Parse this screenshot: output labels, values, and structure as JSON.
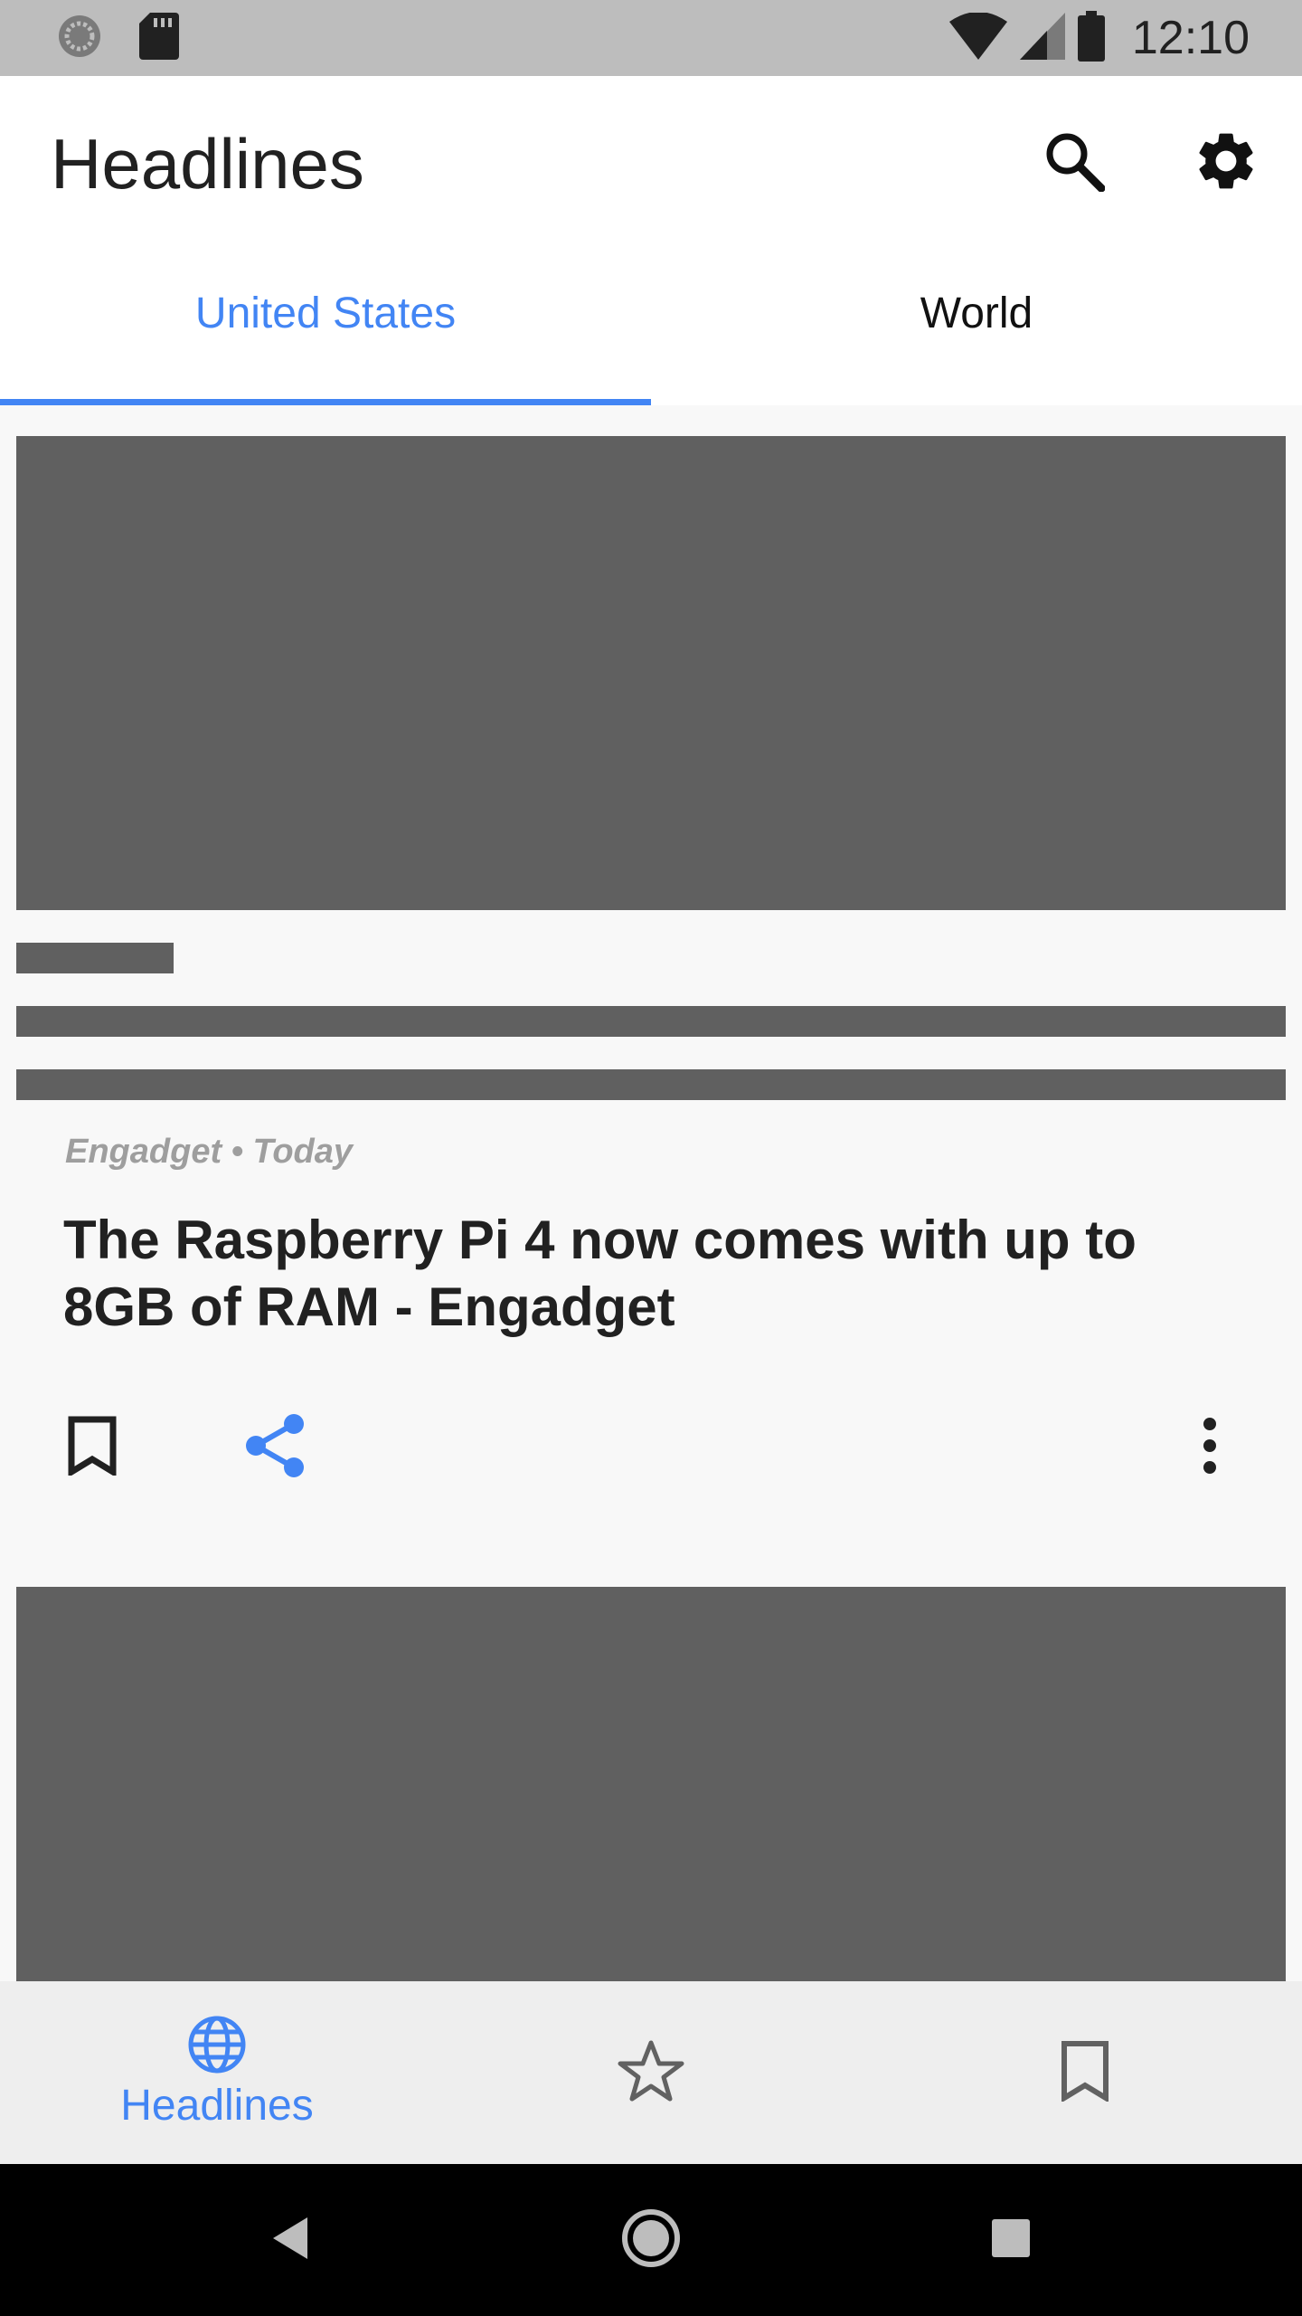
{
  "status_bar": {
    "time": "12:10",
    "icons": [
      "sync-icon",
      "sd-card-icon",
      "wifi-icon",
      "cell-signal-icon",
      "battery-icon"
    ]
  },
  "app_bar": {
    "title": "Headlines",
    "actions": [
      "search-icon",
      "settings-icon"
    ]
  },
  "tabs": [
    {
      "label": "United States",
      "active": true
    },
    {
      "label": "World",
      "active": false
    }
  ],
  "article": {
    "source": "Engadget",
    "separator": "•",
    "date": "Today",
    "meta_text": "Engadget • Today",
    "headline": "The Raspberry Pi 4 now comes with up to 8GB of RAM - Engadget",
    "actions": [
      "bookmark-icon",
      "share-icon",
      "more-vert-icon"
    ]
  },
  "bottom_nav": [
    {
      "icon": "globe-icon",
      "label": "Headlines",
      "active": true
    },
    {
      "icon": "star-icon",
      "label": "",
      "active": false
    },
    {
      "icon": "bookmark-icon",
      "label": "",
      "active": false
    }
  ],
  "system_nav": [
    "back-icon",
    "home-icon",
    "recents-icon"
  ],
  "colors": {
    "accent": "#4285f4",
    "placeholder": "#606060",
    "status_bar": "#bdbdbd",
    "meta_text": "#9e9e9e"
  }
}
